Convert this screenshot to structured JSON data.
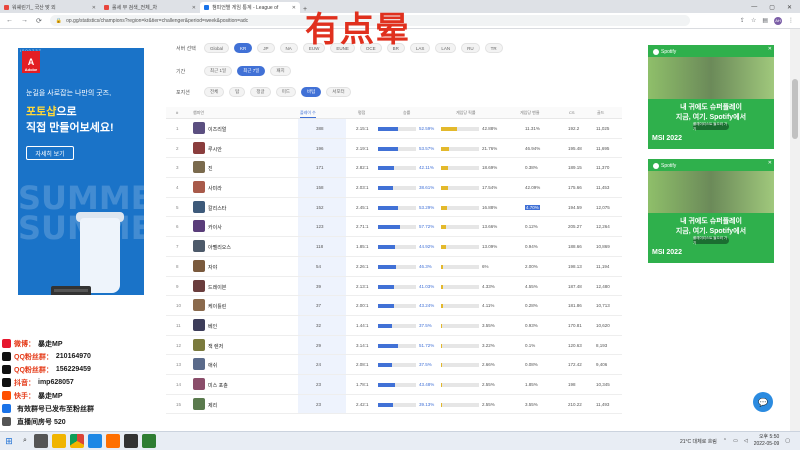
{
  "overlay_caption": "有点晕",
  "browser": {
    "tabs": [
      {
        "label": "워쉐린기_ 국산 맞 외",
        "active": false
      },
      {
        "label": "롤세 부 검색_전체_차",
        "active": false
      },
      {
        "label": "챔피언별 게임 통계 - League of",
        "active": true
      }
    ],
    "new_tab": "+",
    "url": "op.gg/statistics/champions?region=kr&tier=challenger&period=week&position=adc",
    "profile_initials": "AH"
  },
  "filters": {
    "region": {
      "label": "서버 선택",
      "options": [
        "Global",
        "KR",
        "JP",
        "NA",
        "EUW",
        "EUNE",
        "OCE",
        "BR",
        "LAS",
        "LAN",
        "RU",
        "TR"
      ],
      "selected": "KR"
    },
    "period": {
      "label": "기간",
      "options": [
        "최근 1일",
        "최근 7일",
        "패치"
      ],
      "selected": "최근 7일"
    },
    "position": {
      "label": "포지션",
      "options": [
        "전체",
        "탑",
        "정글",
        "미드",
        "바텀",
        "서포터"
      ],
      "selected": "바텀"
    }
  },
  "table": {
    "headers": {
      "rank": "#",
      "champion": "챔피언",
      "games": "플레이 수",
      "kda": "평점",
      "win_rate": "승률",
      "pick_rate": "게임당 픽률",
      "ban_rate": "게임당 밴율",
      "cs": "CS",
      "gold": "골드"
    },
    "rows": [
      {
        "rank": "1",
        "name": "이즈리얼",
        "games": "388",
        "kda": "2.15:1",
        "win": "52.59%",
        "pick": "42.88%",
        "ban": "11.31%",
        "cs": "192.2",
        "gold": "11,025",
        "win_v": 52.59,
        "pick_v": 42.88
      },
      {
        "rank": "2",
        "name": "루시안",
        "games": "196",
        "kda": "2.19:1",
        "win": "53.57%",
        "pick": "21.76%",
        "ban": "46.94%",
        "cs": "195.48",
        "gold": "11,695",
        "win_v": 53.57,
        "pick_v": 21.76
      },
      {
        "rank": "3",
        "name": "진",
        "games": "171",
        "kda": "2.82:1",
        "win": "42.11%",
        "pick": "18.69%",
        "ban": "0.38%",
        "cs": "189.15",
        "gold": "11,370",
        "win_v": 42.11,
        "pick_v": 18.69
      },
      {
        "rank": "4",
        "name": "사미라",
        "games": "158",
        "kda": "2.03:1",
        "win": "38.61%",
        "pick": "17.54%",
        "ban": "42.09%",
        "cs": "175.66",
        "gold": "11,453",
        "win_v": 38.61,
        "pick_v": 17.54
      },
      {
        "rank": "5",
        "name": "칼리스타",
        "games": "152",
        "kda": "2.45:1",
        "win": "53.29%",
        "pick": "16.88%",
        "ban": "4.70%",
        "cs": "194.59",
        "gold": "12,075",
        "win_v": 53.29,
        "pick_v": 16.88,
        "highlight": true
      },
      {
        "rank": "6",
        "name": "카이사",
        "games": "123",
        "kda": "2.71:1",
        "win": "57.72%",
        "pick": "13.66%",
        "ban": "0.12%",
        "cs": "205.27",
        "gold": "12,264",
        "win_v": 57.72,
        "pick_v": 13.66
      },
      {
        "rank": "7",
        "name": "아펠리오스",
        "games": "118",
        "kda": "1.85:1",
        "win": "44.92%",
        "pick": "13.09%",
        "ban": "0.94%",
        "cs": "188.66",
        "gold": "10,869",
        "win_v": 44.92,
        "pick_v": 13.09
      },
      {
        "rank": "8",
        "name": "자야",
        "games": "54",
        "kda": "2.26:1",
        "win": "46.3%",
        "pick": "6%",
        "ban": "2.00%",
        "cs": "198.13",
        "gold": "11,194",
        "win_v": 46.3,
        "pick_v": 6
      },
      {
        "rank": "9",
        "name": "드레이븐",
        "games": "39",
        "kda": "2.13:1",
        "win": "41.03%",
        "pick": "4.33%",
        "ban": "4.55%",
        "cs": "187.48",
        "gold": "12,480",
        "win_v": 41.03,
        "pick_v": 4.33
      },
      {
        "rank": "10",
        "name": "케이틀린",
        "games": "37",
        "kda": "2.00:1",
        "win": "43.24%",
        "pick": "4.11%",
        "ban": "0.28%",
        "cs": "181.86",
        "gold": "10,713",
        "win_v": 43.24,
        "pick_v": 4.11
      },
      {
        "rank": "11",
        "name": "베인",
        "games": "32",
        "kda": "1.44:1",
        "win": "37.5%",
        "pick": "3.55%",
        "ban": "0.93%",
        "cs": "170.81",
        "gold": "10,620",
        "win_v": 37.5,
        "pick_v": 3.55
      },
      {
        "rank": "12",
        "name": "잭 렌저",
        "games": "29",
        "kda": "3.14:1",
        "win": "51.72%",
        "pick": "3.22%",
        "ban": "0.1%",
        "cs": "120.63",
        "gold": "8,193",
        "win_v": 51.72,
        "pick_v": 3.22
      },
      {
        "rank": "13",
        "name": "애쉬",
        "games": "24",
        "kda": "2.08:1",
        "win": "37.5%",
        "pick": "2.66%",
        "ban": "0.08%",
        "cs": "172.42",
        "gold": "9,406",
        "win_v": 37.5,
        "pick_v": 2.66
      },
      {
        "rank": "14",
        "name": "미스 포츈",
        "games": "23",
        "kda": "1.78:1",
        "win": "43.48%",
        "pick": "2.55%",
        "ban": "1.85%",
        "cs": "198",
        "gold": "10,345",
        "win_v": 43.48,
        "pick_v": 2.55
      },
      {
        "rank": "15",
        "name": "제리",
        "games": "23",
        "kda": "2.42:1",
        "win": "39.13%",
        "pick": "2.55%",
        "ban": "3.55%",
        "cs": "210.22",
        "gold": "11,493",
        "win_v": 39.13,
        "pick_v": 2.55
      }
    ]
  },
  "ad_left": {
    "brand": "Adobe",
    "line1": "눈길을 사로잡는 나만의 굿즈,",
    "line2_highlight": "포토샵",
    "line2_rest": "으로",
    "line3": "직접 만들어보세요!",
    "cta": "자세히 보기",
    "bg_word": "SUMMER SUMMER",
    "corner_tag": "i 0 0 0 2 3 7"
  },
  "ad_right": [
    {
      "brand": "Spotify",
      "line1": "내 귀에도 슈퍼플레이",
      "line2": "지금, 여기. Spotify에서",
      "cta": "플레이리스트 들으러 가기",
      "event": "MSI 2022"
    },
    {
      "brand": "Spotify",
      "line1": "내 귀에도 슈퍼플레이",
      "line2": "지금, 여기. Spotify에서",
      "cta": "플레이리스트 들으러 가기",
      "event": "MSI 2022"
    }
  ],
  "stream_info": [
    {
      "label": "微博：",
      "value": "暴走MP",
      "color": "#e6162d"
    },
    {
      "label": "QQ粉丝群：",
      "value": "210164970",
      "color": "#111111"
    },
    {
      "label": "QQ粉丝群：",
      "value": "156229459",
      "color": "#111111"
    },
    {
      "label": "抖音：",
      "value": "imp628057",
      "color": "#111111"
    },
    {
      "label": "快手：",
      "value": "暴走MP",
      "color": "#ff5000"
    },
    {
      "label": "",
      "value": "有效群号已发布至粉丝群",
      "color": "#1a73e8"
    },
    {
      "label": "",
      "value": "直播间房号 520",
      "color": "#555555"
    }
  ],
  "taskbar": {
    "weather": "21°C 대체로 흐림",
    "time": "오후 5:50",
    "date": "2022-05-09"
  }
}
